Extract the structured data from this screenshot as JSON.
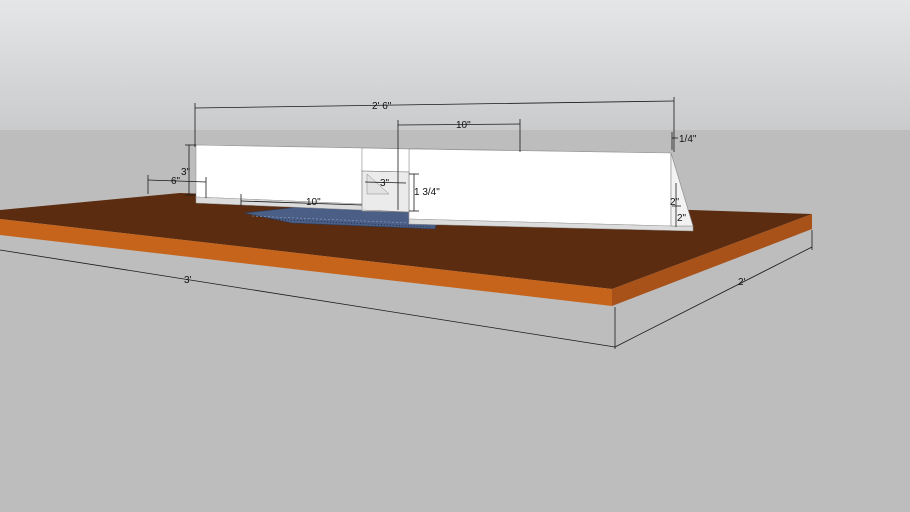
{
  "scene": {
    "colors": {
      "sky_top": "#e4e6e7",
      "sky_bottom": "#c9cbcc",
      "ground": "#bdbdbd",
      "table_top": "#5b2c10",
      "table_edge": "#c6641c",
      "fence": "#ffffff",
      "plate": "#4a5e86"
    },
    "dimensions": {
      "fence_length": "2' 6\"",
      "fence_segment": "10\"",
      "edge_thickness": "1/4\"",
      "fence_height": "3\"",
      "fence_offset": "6\"",
      "lower_segment": "10\"",
      "opening_width": "3\"",
      "opening_height": "1 3/4\"",
      "brace_upper": "2\"",
      "brace_lower": "2\"",
      "table_length": "3'",
      "table_depth": "2'"
    }
  }
}
